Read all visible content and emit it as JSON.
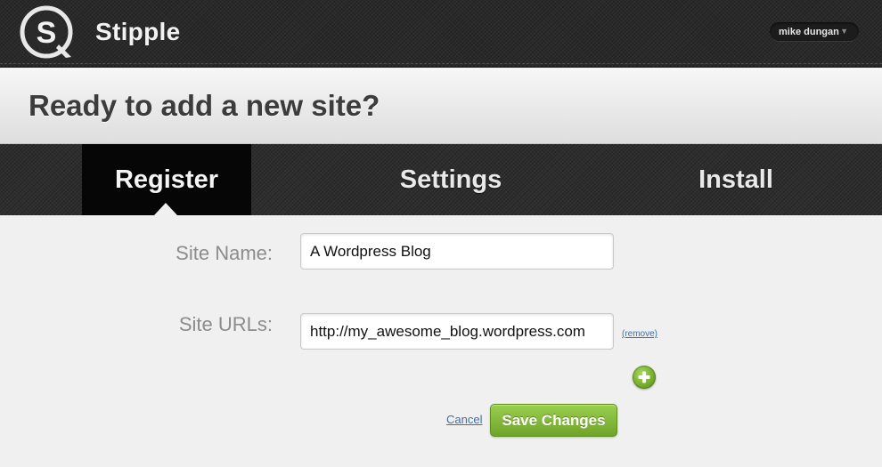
{
  "app": {
    "name": "Stipple",
    "logo_icon": "stipple-logo-icon"
  },
  "user_menu": {
    "name": "mike dungan",
    "icon": "caret-down-icon"
  },
  "page": {
    "title": "Ready to add a new site?"
  },
  "steps": {
    "register": "Register",
    "settings": "Settings",
    "install": "Install",
    "active": "register"
  },
  "form": {
    "site_name_label": "Site Name:",
    "site_name_value": "A Wordpress Blog",
    "site_urls_label": "Site URLs:",
    "site_url_value": "http://my_awesome_blog.wordpress.com",
    "remove_link": "(remove)",
    "add_icon": "plus-circle-icon",
    "cancel_link": "Cancel",
    "save_button": "Save Changes"
  },
  "colors": {
    "accent_green": "#7db536",
    "link_blue": "#3f6fa8",
    "title_gray": "#3c3c3c"
  }
}
